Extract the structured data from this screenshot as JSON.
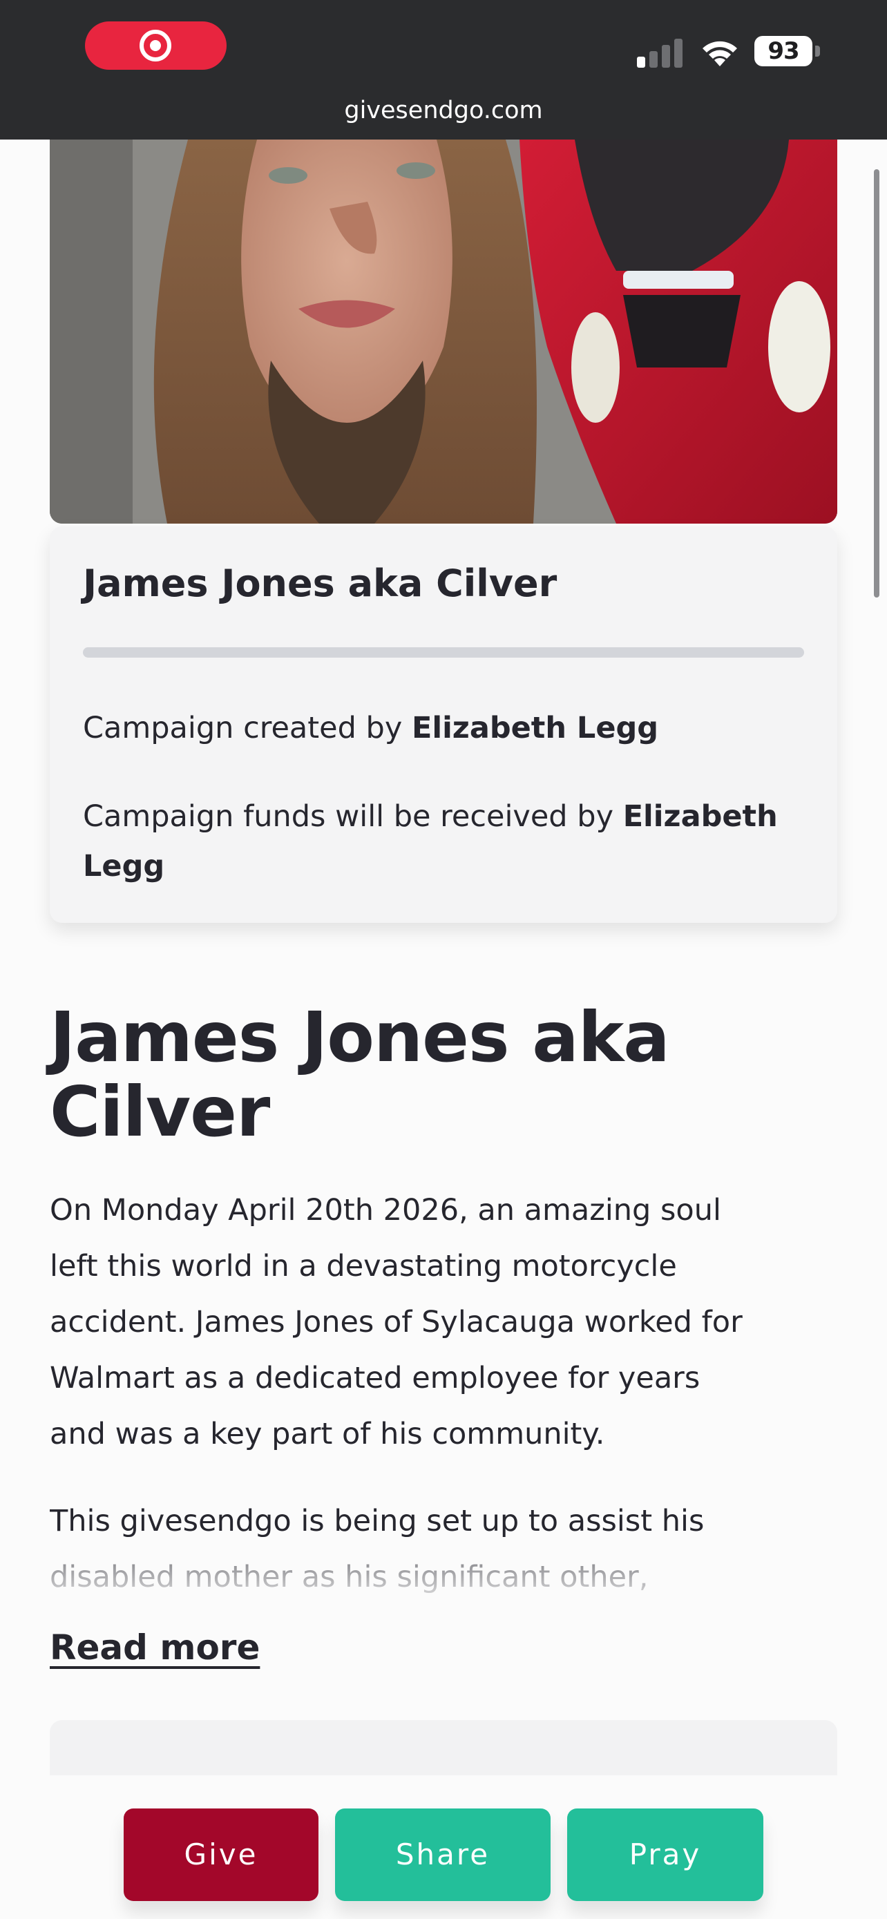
{
  "status_bar": {
    "battery": "93",
    "url": "givesendgo.com",
    "icons": [
      "screen-record-icon",
      "signal-icon",
      "wifi-icon",
      "battery-icon"
    ]
  },
  "campaign": {
    "card_title": "James Jones aka Cilver",
    "progress_fraction": 0.0,
    "creator_prefix": "Campaign created by ",
    "creator_name": "Elizabeth Legg",
    "receiver_prefix": "Campaign funds will be received by ",
    "receiver_name": "Elizabeth Legg"
  },
  "story": {
    "title": "James Jones aka Cilver",
    "paragraph_1": "On Monday April 20th 2026, an amazing soul left this world in a devastating motorcycle accident. James Jones of Sylacauga worked for Walmart as a dedicated employee for years and was a key part of his community.",
    "paragraph_2": "This givesendgo is being set up to assist his disabled mother as his significant other,",
    "read_more": "Read more"
  },
  "actions": {
    "give": "Give",
    "share": "Share",
    "pray": "Pray"
  },
  "colors": {
    "give": "#a3072a",
    "share": "#23bf9a",
    "pray": "#23bf9a",
    "record": "#e8253f"
  }
}
